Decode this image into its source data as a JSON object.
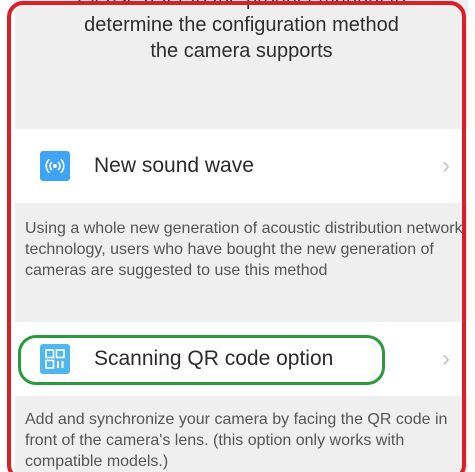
{
  "intro": {
    "line1": "Please refer to the product manual to",
    "line2": "determine the configuration method",
    "line3": "the camera supports"
  },
  "options": [
    {
      "label": "New sound wave",
      "icon": "sound-wave-icon",
      "description": "Using a whole new generation of acoustic distribution network technology, users who have bought the new generation of cameras are suggested to use this method"
    },
    {
      "label": "Scanning QR code option",
      "icon": "qr-code-icon",
      "description": "Add and synchronize your camera by facing the QR code in front of the camera's lens. (this option only works with compatible models.)"
    }
  ],
  "chevron": "›",
  "colors": {
    "highlight_red": "#dc1e28",
    "highlight_green": "#2a9a3c",
    "icon_blue": "#3fa4f5"
  }
}
